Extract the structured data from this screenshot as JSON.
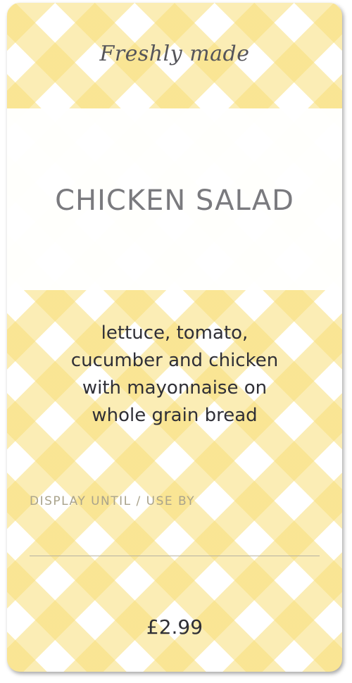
{
  "label": {
    "tagline": "Freshly made",
    "product_name": "CHICKEN SALAD",
    "ingredients_lines": [
      "lettuce, tomato,",
      "cucumber and chicken",
      "with mayonnaise on",
      "whole grain bread"
    ],
    "display_until_label": "DISPLAY UNTIL / USE BY",
    "price": "£2.99"
  },
  "colors": {
    "gingham_yellow": "#f8de78",
    "background": "#ffffff",
    "title_gray": "#7a7a7e",
    "text_dark": "#2f2f36"
  }
}
